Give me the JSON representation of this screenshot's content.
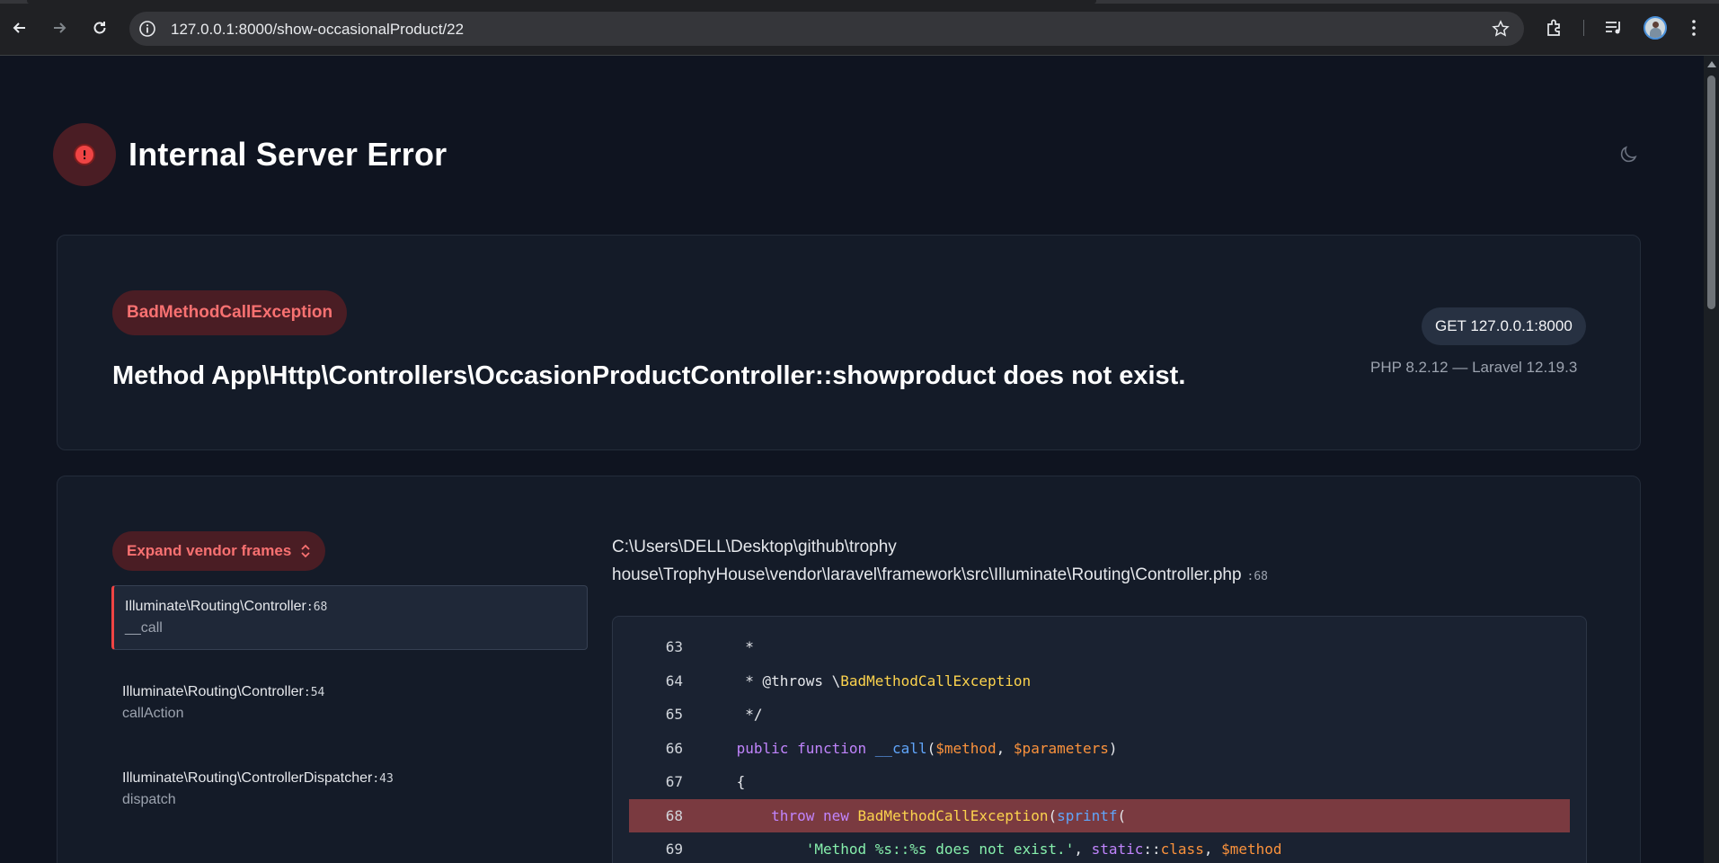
{
  "browser": {
    "url": "127.0.0.1:8000/show-occasionalProduct/22"
  },
  "error": {
    "title": "Internal Server Error",
    "exception_class": "BadMethodCallException",
    "message": "Method App\\Http\\Controllers\\OccasionProductController::showproduct does not exist.",
    "request": "GET 127.0.0.1:8000",
    "versions": "PHP 8.2.12 — Laravel 12.19.3"
  },
  "trace": {
    "expand_label": "Expand vendor frames",
    "frames": [
      {
        "class": "Illuminate\\Routing\\Controller",
        "line": ":68",
        "function": "__call"
      },
      {
        "class": "Illuminate\\Routing\\Controller",
        "line": ":54",
        "function": "callAction"
      },
      {
        "class": "Illuminate\\Routing\\ControllerDispatcher",
        "line": ":43",
        "function": "dispatch"
      }
    ],
    "file_path": "C:\\Users\\DELL\\Desktop\\github\\trophy house\\TrophyHouse\\vendor\\laravel\\framework\\src\\Illuminate\\Routing\\Controller.php",
    "file_line": ":68"
  },
  "code": {
    "lines": [
      {
        "num": "63"
      },
      {
        "num": "64"
      },
      {
        "num": "65"
      },
      {
        "num": "66"
      },
      {
        "num": "67"
      },
      {
        "num": "68"
      },
      {
        "num": "69"
      }
    ],
    "highlighted_line": "68"
  },
  "colors": {
    "error_red": "#ef4444",
    "background": "#0f1420",
    "card": "#141b28",
    "highlight": "#7a3a40"
  }
}
